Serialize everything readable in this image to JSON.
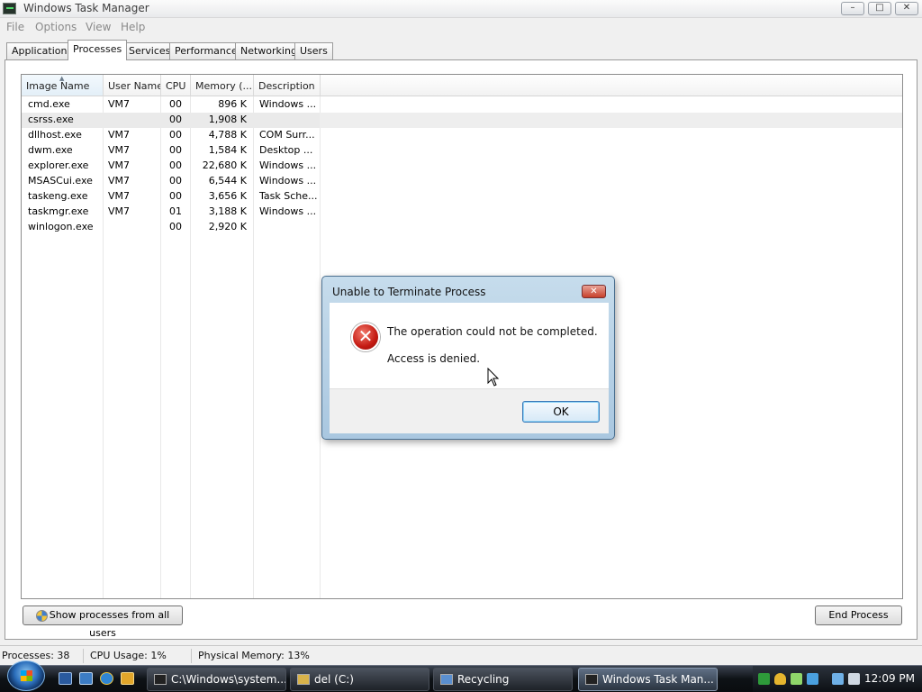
{
  "window": {
    "title": "Windows Task Manager",
    "controls": {
      "minimize": "–",
      "maximize": "□",
      "close": "✕"
    }
  },
  "menu": [
    "File",
    "Options",
    "View",
    "Help"
  ],
  "tabs": [
    {
      "label": "Applications",
      "active": false
    },
    {
      "label": "Processes",
      "active": true
    },
    {
      "label": "Services",
      "active": false
    },
    {
      "label": "Performance",
      "active": false
    },
    {
      "label": "Networking",
      "active": false
    },
    {
      "label": "Users",
      "active": false
    }
  ],
  "process_table": {
    "columns": [
      "Image Name",
      "User Name",
      "CPU",
      "Memory (...",
      "Description"
    ],
    "sorted_by": "Image Name",
    "selected_row": 1,
    "rows": [
      [
        "cmd.exe",
        "VM7",
        "00",
        "896 K",
        "Windows ..."
      ],
      [
        "csrss.exe",
        "",
        "00",
        "1,908 K",
        ""
      ],
      [
        "dllhost.exe",
        "VM7",
        "00",
        "4,788 K",
        "COM Surr..."
      ],
      [
        "dwm.exe",
        "VM7",
        "00",
        "1,584 K",
        "Desktop ..."
      ],
      [
        "explorer.exe",
        "VM7",
        "00",
        "22,680 K",
        "Windows ..."
      ],
      [
        "MSASCui.exe",
        "VM7",
        "00",
        "6,544 K",
        "Windows ..."
      ],
      [
        "taskeng.exe",
        "VM7",
        "00",
        "3,656 K",
        "Task Sche..."
      ],
      [
        "taskmgr.exe",
        "VM7",
        "01",
        "3,188 K",
        "Windows ..."
      ],
      [
        "winlogon.exe",
        "",
        "00",
        "2,920 K",
        ""
      ]
    ]
  },
  "buttons": {
    "show_all": "Show processes from all users",
    "end_process": "End Process"
  },
  "status": {
    "processes": "Processes: 38",
    "cpu": "CPU Usage: 1%",
    "memory": "Physical Memory: 13%"
  },
  "dialog": {
    "title": "Unable to Terminate Process",
    "message": "The operation could not be completed.",
    "detail": "Access is denied.",
    "ok": "OK",
    "icon": "error-icon"
  },
  "taskbar": {
    "items": [
      {
        "label": "C:\\Windows\\system...",
        "active": false
      },
      {
        "label": "del (C:)",
        "active": false
      },
      {
        "label": "Recycling",
        "active": false
      },
      {
        "label": "Windows Task Man...",
        "active": true
      }
    ],
    "clock": "12:09 PM"
  }
}
